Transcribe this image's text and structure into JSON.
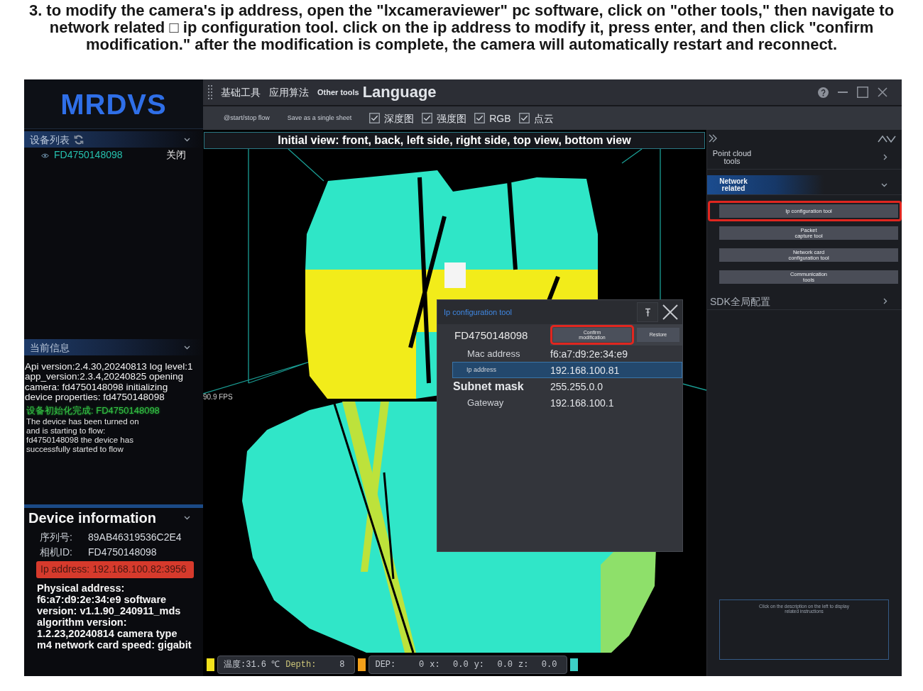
{
  "caption": "3. to modify the camera's ip address, open the \"lxcameraviewer\" pc software, click on \"other tools,\" then navigate to network related □ ip configuration tool. click on the ip address to modify it, press enter, and then click \"confirm modification.\" after the modification is complete, the camera will automatically restart and reconnect.",
  "app": {
    "logo": "MRDVS",
    "sidebar": {
      "device_list": {
        "title": "设备列表",
        "expanded": true,
        "devices": [
          {
            "serial": "FD4750148098",
            "action": "关闭"
          }
        ]
      },
      "current_info": {
        "title": "当前信息",
        "expanded": true,
        "log": [
          {
            "kind": "normal",
            "text": "Api version:2.4.30,20240813 log level:1 app_version:2.3.4,20240825 opening camera: fd4750148098 initializing device properties: fd4750148098"
          },
          {
            "kind": "success",
            "text": "设备初始化完成: FD4750148098"
          },
          {
            "kind": "small",
            "text": "The device has been turned on and is starting to flow: fd4750148098 the device has successfully started to flow"
          }
        ]
      },
      "device_information": {
        "title": "Device information",
        "expanded": true,
        "fields": [
          {
            "label": "序列号:",
            "value": "89AB46319536C2E4",
            "highlighted": false
          },
          {
            "label": "相机ID:",
            "value": "FD4750148098",
            "highlighted": false
          },
          {
            "label": "Ip address:",
            "value": "192.168.100.82:3956",
            "highlighted": true
          }
        ],
        "details": "Physical address: f6:a7:d9:2e:34:e9 software version: v1.1.90_240911_mds algorithm version: 1.2.23,20240814 camera type m4 network card speed: gigabit"
      }
    },
    "menu": [
      {
        "label": "基础工具",
        "kind": "normal"
      },
      {
        "label": "应用算法",
        "kind": "normal"
      },
      {
        "label": "Other tools",
        "kind": "small"
      },
      {
        "label": "Language",
        "kind": "large"
      }
    ],
    "toolbar": {
      "actions": [
        "@start/stop flow",
        "Save as a single sheet"
      ],
      "checkboxes": [
        {
          "label": "深度图",
          "checked": true
        },
        {
          "label": "强度图",
          "checked": true
        },
        {
          "label": "RGB",
          "checked": true
        },
        {
          "label": "点云",
          "checked": true
        }
      ]
    },
    "viewport": {
      "view_title": "Initial view: front, back, left side, right side, top view, bottom view",
      "fps": "90.9 FPS"
    },
    "dialog": {
      "title": "Ip configuration tool",
      "device": "FD4750148098",
      "buttons": [
        {
          "label": "Confirm\nmodification",
          "highlighted": true
        },
        {
          "label": "Restore",
          "highlighted": false
        }
      ],
      "rows": [
        {
          "label": "Mac address",
          "value": "f6:a7:d9:2e:34:e9",
          "kind": "normal",
          "selected": false
        },
        {
          "label": "Ip address",
          "value": "192.168.100.81",
          "kind": "small",
          "selected": true
        },
        {
          "label": "Subnet mask",
          "value": "255.255.0.0",
          "kind": "large",
          "selected": false
        },
        {
          "label": "Gateway",
          "value": "192.168.100.1",
          "kind": "normal",
          "selected": false
        }
      ]
    },
    "tool_panel": {
      "sections": [
        {
          "title": "Point cloud\ntools",
          "kind": "compact",
          "selected": false,
          "expanded": false
        },
        {
          "title": "Network\nrelated",
          "kind": "compact",
          "selected": true,
          "expanded": true,
          "tools": [
            {
              "label": "Ip configuration tool",
              "highlighted": true
            },
            {
              "label": "Packet\ncapture tool",
              "highlighted": false
            },
            {
              "label": "Network card\nconfiguration tool",
              "highlighted": false
            },
            {
              "label": "Communication\ntools",
              "highlighted": false
            }
          ]
        },
        {
          "title": "SDK全局配置",
          "kind": "plain",
          "selected": false,
          "expanded": false
        }
      ],
      "help_text": "Click on the description on the left to display\nrelated instructions"
    },
    "status_bar": [
      {
        "kind": "swatch",
        "color": "#f2e21c"
      },
      {
        "kind": "readout",
        "fields": [
          {
            "label": "温度:",
            "value": "31.6 ℃"
          },
          {
            "label": "Depth:",
            "value": "8"
          }
        ]
      },
      {
        "kind": "swatch",
        "color": "#f3a01a"
      },
      {
        "kind": "readout",
        "fields": [
          {
            "label": "DEP:",
            "value": "0"
          },
          {
            "label": "x:",
            "value": "0.0"
          },
          {
            "label": "y:",
            "value": "0.0"
          },
          {
            "label": "z:",
            "value": "0.0"
          }
        ]
      },
      {
        "kind": "swatch",
        "color": "#3ccfc6"
      }
    ]
  }
}
